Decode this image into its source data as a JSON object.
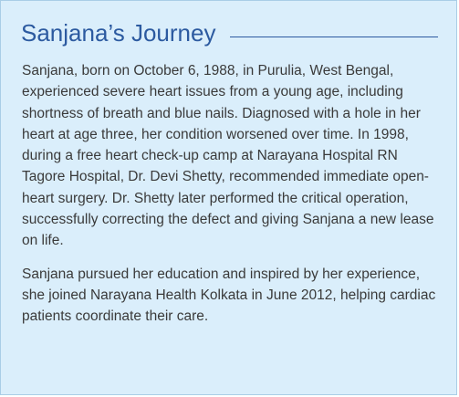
{
  "article": {
    "title": "Sanjana’s Journey",
    "paragraphs": [
      "Sanjana, born on October 6, 1988, in Purulia, West Bengal, experienced severe heart issues from a young age, including shortness of breath and blue nails. Diagnosed with a hole in her heart at age three, her condition worsened over time. In 1998, during a free heart check-up camp at Narayana Hospital RN Tagore Hospital, Dr. Devi Shetty, recommended immediate open-heart surgery. Dr. Shetty later performed the critical operation, successfully correcting the defect and giving Sanjana a new lease on life.",
      "Sanjana pursued her education and inspired by her experience, she joined Narayana Health Kolkata in June 2012, helping cardiac patients coordinate their care."
    ]
  },
  "colors": {
    "panel_background": "#daeefb",
    "title": "#2c5aa0",
    "body_text": "#3a3a3a"
  }
}
